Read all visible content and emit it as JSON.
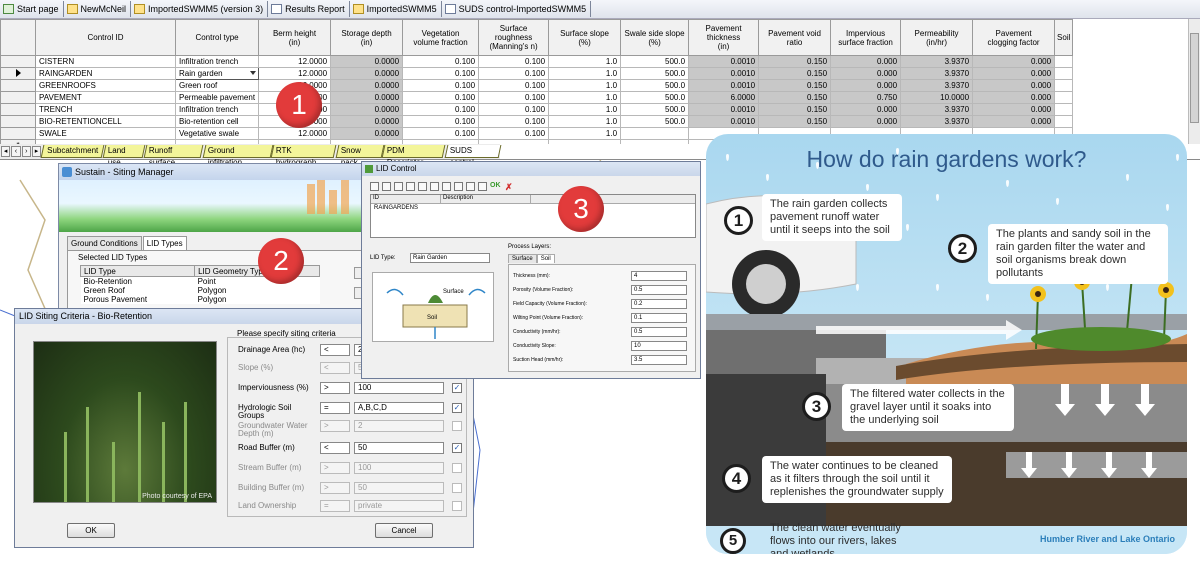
{
  "top_tabs": [
    "Start page",
    "NewMcNeil",
    "ImportedSWMM5 (version 3)",
    "Results Report",
    "ImportedSWMM5",
    "SUDS control-ImportedSWMM5"
  ],
  "grid": {
    "headers": [
      "Control ID",
      "Control type",
      "Berm height\n(in)",
      "Storage depth\n(in)",
      "Vegetation\nvolume fraction",
      "Surface\nroughness\n(Manning's n)",
      "Surface slope\n(%)",
      "Swale side slope\n(%)",
      "Pavement\nthickness\n(in)",
      "Pavement void\nratio",
      "Impervious\nsurface fraction",
      "Permeability\n(in/hr)",
      "Pavement\nclogging factor",
      "Soil"
    ],
    "rows": [
      [
        "CISTERN",
        "Infiltration trench",
        "12.0000",
        "0.0000",
        "0.100",
        "0.100",
        "1.0",
        "500.0",
        "0.0010",
        "0.150",
        "0.000",
        "3.9370",
        "0.000"
      ],
      [
        "RAINGARDEN",
        "Rain garden",
        "12.0000",
        "0.0000",
        "0.100",
        "0.100",
        "1.0",
        "500.0",
        "0.0010",
        "0.150",
        "0.000",
        "3.9370",
        "0.000"
      ],
      [
        "GREENROOFS",
        "Green roof",
        "12.0000",
        "0.0000",
        "0.100",
        "0.100",
        "1.0",
        "500.0",
        "0.0010",
        "0.150",
        "0.000",
        "3.9370",
        "0.000"
      ],
      [
        "PAVEMENT",
        "Permeable pavement",
        "12.0000",
        "0.0000",
        "0.100",
        "0.100",
        "1.0",
        "500.0",
        "6.0000",
        "0.150",
        "0.750",
        "10.0000",
        "0.000"
      ],
      [
        "TRENCH",
        "Infiltration trench",
        "12.0000",
        "0.0000",
        "0.100",
        "0.100",
        "1.0",
        "500.0",
        "0.0010",
        "0.150",
        "0.000",
        "3.9370",
        "0.000"
      ],
      [
        "BIO-RETENTIONCELL",
        "Bio-retention cell",
        "12.0000",
        "0.0000",
        "0.100",
        "0.100",
        "1.0",
        "500.0",
        "0.0010",
        "0.150",
        "0.000",
        "3.9370",
        "0.000"
      ],
      [
        "SWALE",
        "Vegetative swale",
        "12.0000",
        "0.0000",
        "0.100",
        "0.100",
        "1.0",
        "",
        "",
        "",
        "",
        "",
        ""
      ]
    ],
    "new_row_marker": "*"
  },
  "sheet_tabs": [
    "Subcatchment",
    "Land use",
    "Runoff surface",
    "Ground infiltration",
    "RTK hydrograph",
    "Snow pack",
    "PDM Descriptor",
    "SUDS control"
  ],
  "circles": [
    "1",
    "2",
    "3"
  ],
  "sustain": {
    "title": "Sustain - Siting Manager",
    "tabs": [
      "Ground Conditions",
      "LID Types"
    ],
    "selected_label": "Selected LID Types",
    "table_headers": [
      "LID Type",
      "LID Geometry Type"
    ],
    "table_rows": [
      [
        "Bio-Retention",
        "Point"
      ],
      [
        "Green Roof",
        "Polygon"
      ],
      [
        "Porous Pavement",
        "Polygon"
      ]
    ]
  },
  "siting": {
    "title": "LID Siting Criteria - Bio-Retention",
    "prompt": "Please specify siting criteria",
    "photo_credit": "Photo courtesy of EPA",
    "criteria": [
      {
        "label": "Drainage Area (hc)",
        "op": "<",
        "value": "2",
        "checked": "✓",
        "enabled": true
      },
      {
        "label": "Slope (%)",
        "op": "<",
        "value": "5",
        "checked": "",
        "enabled": false
      },
      {
        "label": "Imperviousness (%)",
        "op": ">",
        "value": "100",
        "checked": "✓",
        "enabled": true
      },
      {
        "label": "Hydrologic Soil Groups",
        "op": "=",
        "value": "A,B,C,D",
        "checked": "✓",
        "enabled": true
      },
      {
        "label": "Groundwater Water Depth (m)",
        "op": ">",
        "value": "2",
        "checked": "",
        "enabled": false
      },
      {
        "label": "Road Buffer (m)",
        "op": "<",
        "value": "50",
        "checked": "✓",
        "enabled": true
      },
      {
        "label": "Stream Buffer (m)",
        "op": ">",
        "value": "100",
        "checked": "",
        "enabled": false
      },
      {
        "label": "Building Buffer (m)",
        "op": ">",
        "value": "50",
        "checked": "",
        "enabled": false
      },
      {
        "label": "Land Ownership",
        "op": "=",
        "value": "private",
        "checked": "",
        "enabled": false
      }
    ],
    "ok_label": "OK",
    "cancel_label": "Cancel"
  },
  "lid_control": {
    "title": "LID Control",
    "list_headers": [
      "ID",
      "Description"
    ],
    "list_rows": [
      "RAINGARDENS"
    ],
    "ok_text": "OK",
    "lid_type_label": "LID Type:",
    "lid_type_value": "Rain Garden",
    "process_layers": "Process Layers:",
    "subtabs": [
      "Surface",
      "Soil"
    ],
    "diagram_surface": "Surface",
    "diagram_soil": "Soil",
    "params": [
      {
        "label": "Thickness (mm):",
        "value": "4"
      },
      {
        "label": "Porosity (Volume Fraction):",
        "value": "0.5"
      },
      {
        "label": "Field Capacity (Volume Fraction):",
        "value": "0.2"
      },
      {
        "label": "Wilting Point (Volume Fraction):",
        "value": "0.1"
      },
      {
        "label": "Conductivity (mm/hr):",
        "value": "0.5"
      },
      {
        "label": "Conductivity Slope:",
        "value": "10"
      },
      {
        "label": "Suction Head (mm/hr):",
        "value": "3.5"
      }
    ]
  },
  "infographic": {
    "title": "How do rain gardens work?",
    "steps": [
      {
        "num": "1",
        "text": "The rain garden collects pavement runoff water until it seeps into the soil"
      },
      {
        "num": "2",
        "text": "The plants and sandy soil in the rain garden filter the water and soil organisms break down pollutants"
      },
      {
        "num": "3",
        "text": "The filtered water collects in the gravel layer until it soaks into the underlying soil"
      },
      {
        "num": "4",
        "text": "The water continues to be cleaned as it filters through the soil until it replenishes the groundwater supply"
      },
      {
        "num": "5",
        "text": "The clean water eventually flows into our rivers, lakes and wetlands"
      }
    ],
    "brand": "Humber River and Lake Ontario"
  },
  "colors": {
    "red_circle": "#e23b3b",
    "info_title": "#2f5a8c",
    "brand": "#2c7fba",
    "sheet_tab": "#f3f59a"
  }
}
